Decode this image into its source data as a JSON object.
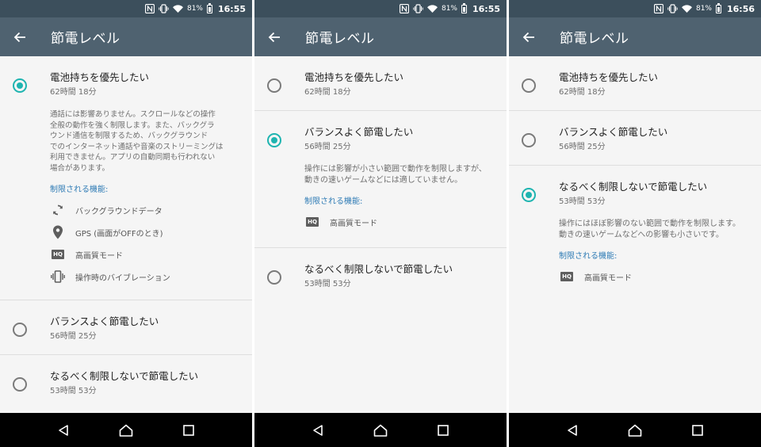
{
  "screens": [
    {
      "status": {
        "battery_pct": "81%",
        "time": "16:55"
      },
      "app_bar": {
        "title": "節電レベル"
      },
      "options": [
        {
          "title": "電池持ちを優先したい",
          "time": "62時間 18分",
          "selected": true,
          "description": "通話には影響ありません。スクロールなどの操作\n全般の動作を強く制限します。また、バックグラ\nウンド通信を制限するため、バックグラウンド\nでのインターネット通話や音楽のストリーミングは\n利用できません。アプリの自動同期も行われない\n場合があります。",
          "features_heading": "制限される機能:",
          "features": [
            {
              "icon": "sync-icon",
              "label": "バックグラウンドデータ"
            },
            {
              "icon": "location-pin-icon",
              "label": "GPS (画面がOFFのとき)"
            },
            {
              "icon": "hq-icon",
              "label": "高画質モード"
            },
            {
              "icon": "vibration-icon",
              "label": "操作時のバイブレーション"
            }
          ]
        },
        {
          "title": "バランスよく節電したい",
          "time": "56時間 25分",
          "selected": false
        },
        {
          "title": "なるべく制限しないで節電したい",
          "time": "53時間 53分",
          "selected": false
        }
      ]
    },
    {
      "status": {
        "battery_pct": "81%",
        "time": "16:55"
      },
      "app_bar": {
        "title": "節電レベル"
      },
      "options": [
        {
          "title": "電池持ちを優先したい",
          "time": "62時間 18分",
          "selected": false
        },
        {
          "title": "バランスよく節電したい",
          "time": "56時間 25分",
          "selected": true,
          "description": "操作には影響が小さい範囲で動作を制限しますが、動きの速いゲームなどには適していません。",
          "features_heading": "制限される機能:",
          "features": [
            {
              "icon": "hq-icon",
              "label": "高画質モード"
            }
          ]
        },
        {
          "title": "なるべく制限しないで節電したい",
          "time": "53時間 53分",
          "selected": false
        }
      ]
    },
    {
      "status": {
        "battery_pct": "81%",
        "time": "16:56"
      },
      "app_bar": {
        "title": "節電レベル"
      },
      "options": [
        {
          "title": "電池持ちを優先したい",
          "time": "62時間 18分",
          "selected": false
        },
        {
          "title": "バランスよく節電したい",
          "time": "56時間 25分",
          "selected": false
        },
        {
          "title": "なるべく制限しないで節電したい",
          "time": "53時間 53分",
          "selected": true,
          "description": "操作にはほぼ影響のない範囲で動作を制限します。動きの速いゲームなどへの影響も小さいです。",
          "features_heading": "制限される機能:",
          "features": [
            {
              "icon": "hq-icon",
              "label": "高画質モード"
            }
          ]
        }
      ]
    }
  ],
  "status_icons": [
    "nfc-icon",
    "vibrate-icon",
    "wifi-icon",
    "battery-icon"
  ],
  "nav_icons": [
    "back-triangle-icon",
    "home-icon",
    "recents-icon"
  ],
  "colors": {
    "status_bar": "#3c4f5c",
    "app_bar": "#4f6270",
    "accent_radio": "#1eb4b0",
    "features_heading": "#2e7bb5",
    "background": "#f5f5f5",
    "nav_bar": "#000000"
  }
}
